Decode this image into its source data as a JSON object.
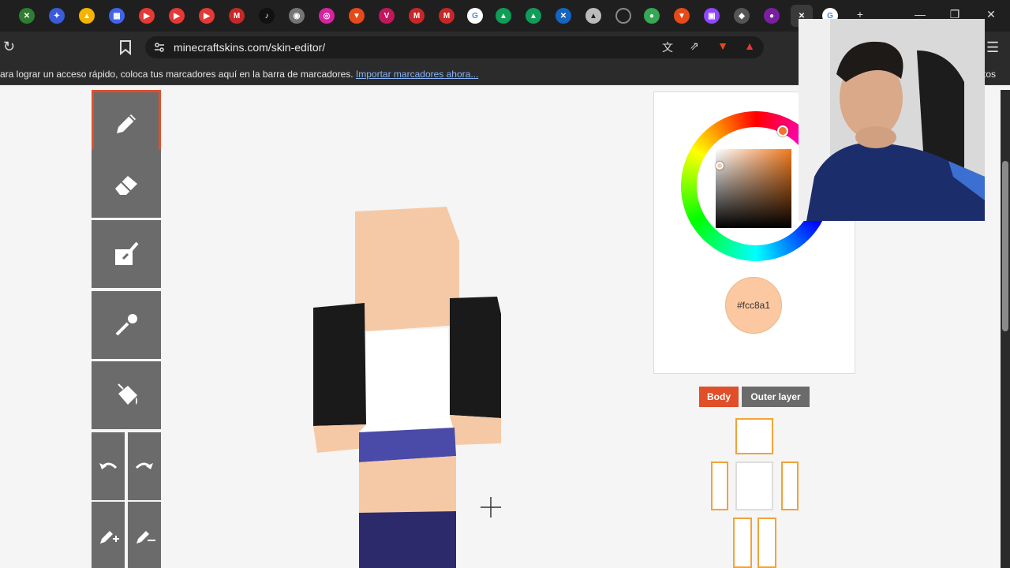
{
  "browser": {
    "url": "minecraftskins.com/skin-editor/",
    "bookmarks_message": "ara lograr un acceso rápido, coloca tus marcadores aquí en la barra de marcadores.",
    "bookmarks_import_link": "Importar marcadores ahora...",
    "bookmarks_right_fragment": "tos",
    "tab_icons": [
      "green-x-icon",
      "sparkle-icon",
      "drive-icon",
      "grid-icon",
      "youtube-icon",
      "youtube-icon",
      "youtube-icon",
      "gmail-icon",
      "tiktok-icon",
      "chrome-icon",
      "instagram-icon",
      "brave-icon",
      "vivaldi-icon",
      "gmail-icon",
      "google-icon",
      "drive-icon",
      "drive-icon",
      "xbox-icon",
      "drive-icon",
      "loading-icon",
      "maps-icon",
      "brave-icon",
      "twitch-icon",
      "shield-icon",
      "app-icon",
      "close-icon",
      "google-icon"
    ],
    "new_tab_label": "+"
  },
  "editor": {
    "tools": [
      "pencil-icon",
      "eraser-icon",
      "brush-icon",
      "eyedropper-icon",
      "bucket-icon"
    ],
    "undo_icon": "undo-icon",
    "redo_icon": "redo-icon",
    "lighten_icon": "lighten-icon",
    "darken_icon": "darken-icon",
    "current_color": "#fcc8a1",
    "color_label": "#fcc8a1",
    "layer_body_label": "Body",
    "layer_outer_label": "Outer layer",
    "accent": "#e04e2a",
    "part_border": "#f2a33a"
  },
  "skin_colors": {
    "skin": "#f6c9a6",
    "sleeve": "#1a1a1a",
    "shirt": "#ffffff",
    "belt": "#4a4aa8",
    "pants": "#2c2a6a"
  }
}
